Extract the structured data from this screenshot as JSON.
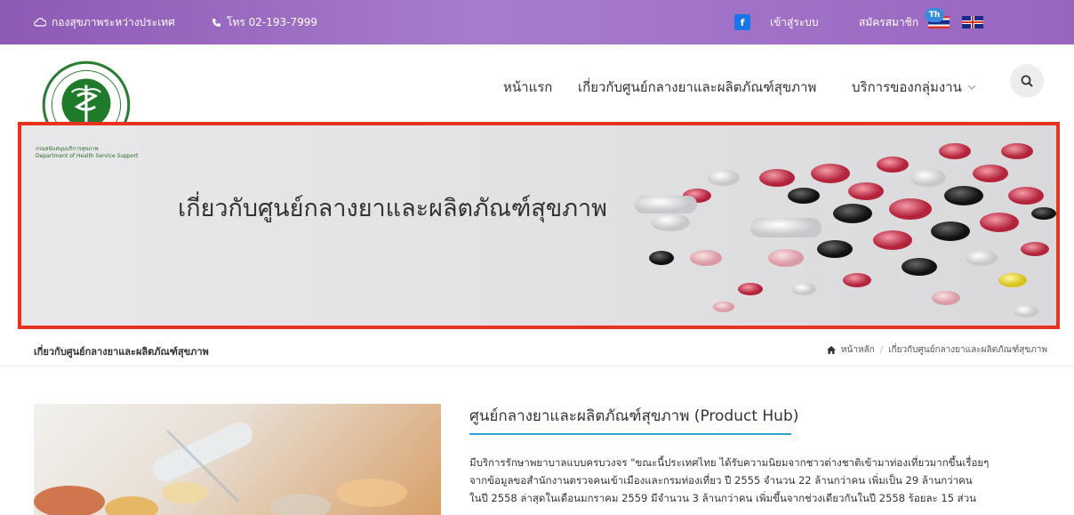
{
  "topbar": {
    "org_link": "กองสุขภาพระหว่างประเทศ",
    "phone": "โทร 02-193-7999",
    "facebook_glyph": "f",
    "login": "เข้าสู่ระบบ",
    "register": "สมัครสมาชิก",
    "lang_badge": "Th"
  },
  "logo": {
    "caption_th": "กรมสนับสนุนบริการสุขภาพ",
    "caption_en": "Department of Health Service Support"
  },
  "nav": {
    "home": "หน้าแรก",
    "about": "เกี่ยวกับศูนย์กลางยาและผลิตภัณฑ์สุขภาพ",
    "services": "บริการของกลุ่มงาน"
  },
  "banner": {
    "title": "เกี่ยวกับศูนย์กลางยาและผลิตภัณฑ์สุขภาพ"
  },
  "breadcrumb": {
    "page_title": "เกี่ยวกับศูนย์กลางยาและผลิตภัณฑ์สุขภาพ",
    "home": "หน้าหลัก",
    "separator": "/",
    "current": "เกี่ยวกับศูนย์กลางยาและผลิตภัณฑ์สุขภาพ"
  },
  "article": {
    "title": "ศูนย์กลางยาและผลิตภัณฑ์สุขภาพ (Product Hub)",
    "lines": [
      "มีบริการรักษาพยาบาลแบบครบวงจร \"ขณะนี้ประเทศไทย ได้รับความนิยมจากชาวต่างชาติเข้ามาท่องเที่ยวมากขึ้นเรื่อยๆ",
      "จากข้อมูลขอสำนักงานตรวจคนเข้าเมืองและกรมท่องเที่ยว ปี 2555 จำนวน 22 ล้านกว่าคน เพิ่มเป็น 29 ล้านกว่าคน",
      "ในปี 2558 ล่าสุดในเดือนมกราคม 2559 มีจำนวน 3 ล้านกว่าคน เพิ่มขึ้นจากช่วงเดียวกันในปี 2558 ร้อยละ 15 ส่วน"
    ]
  },
  "colors": {
    "topbar": "#9866c1",
    "accent_underline": "#2ba2d6",
    "highlight_box": "#e8321f",
    "facebook": "#1976e8"
  },
  "icons": [
    "cloud-icon",
    "phone-icon",
    "facebook-icon",
    "thai-flag-icon",
    "uk-flag-icon",
    "ministry-logo",
    "chevron-down-icon",
    "search-icon",
    "home-icon"
  ]
}
